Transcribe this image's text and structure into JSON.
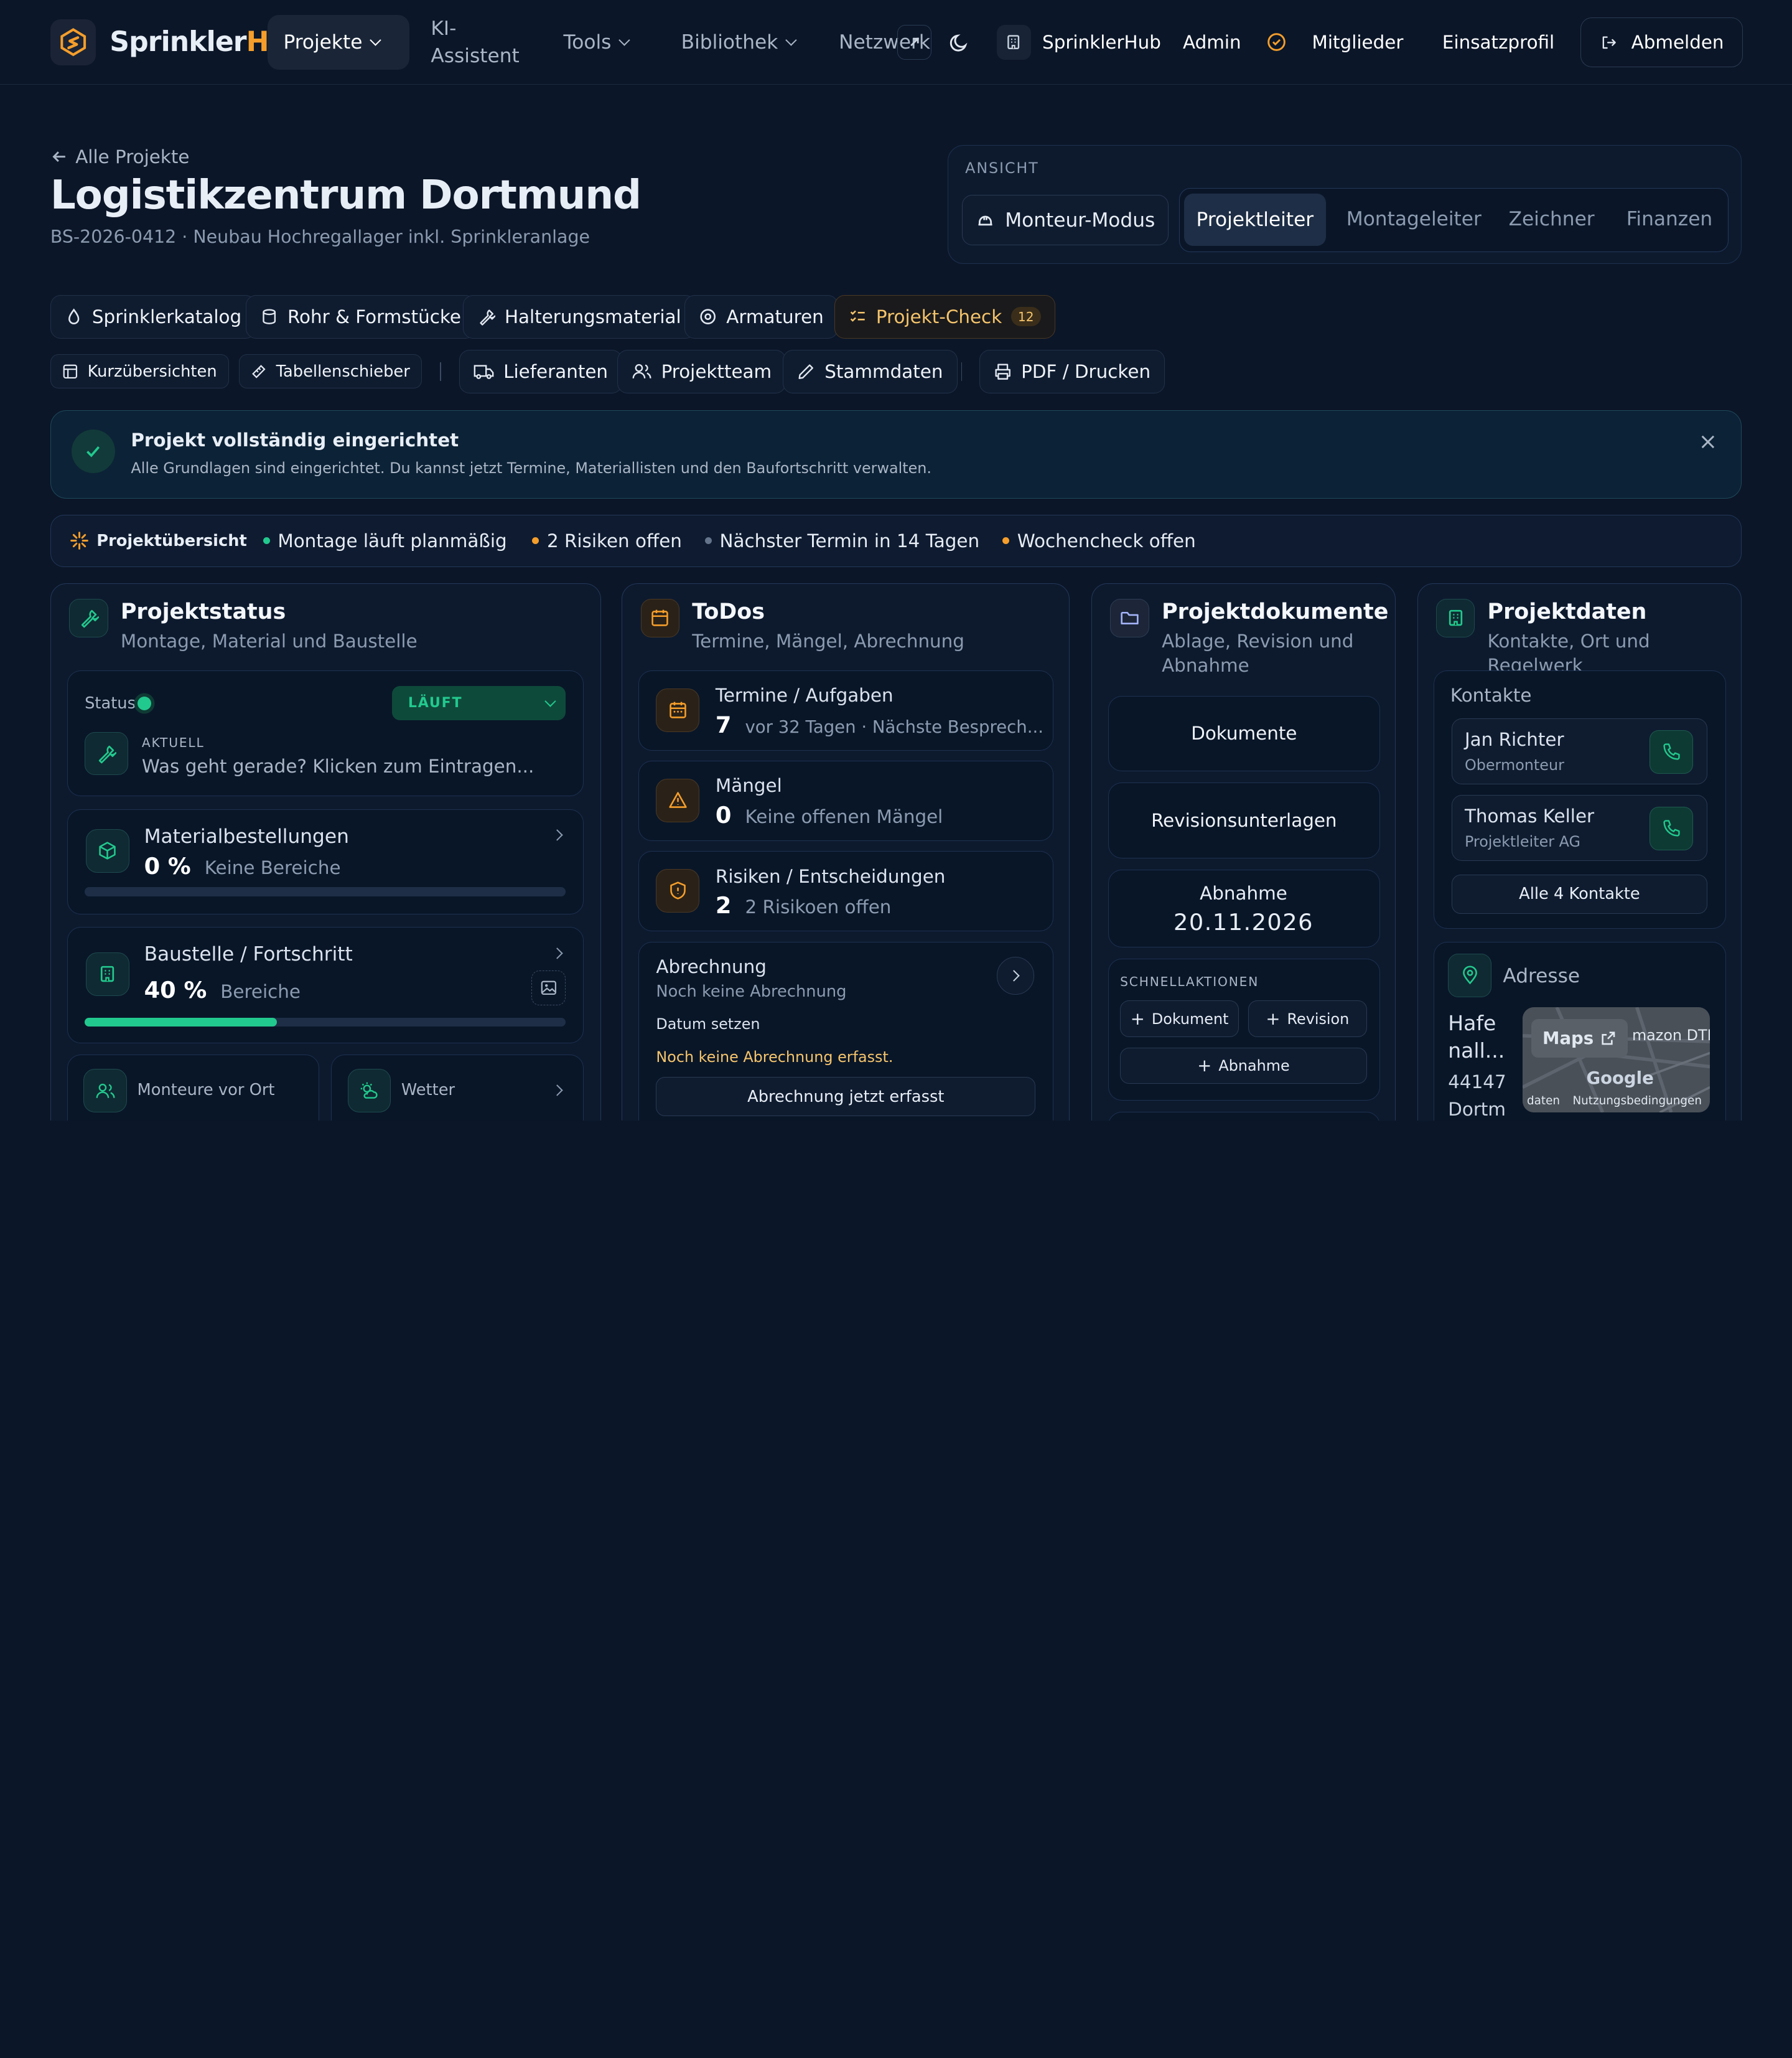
{
  "nav": {
    "brand_a": "Sprinkler",
    "brand_b": "Hub",
    "items": [
      "Projekte",
      "KI-\nAssistent",
      "Tools",
      "Bibliothek",
      "Netzwerk"
    ],
    "org": "SprinklerHub",
    "admin": "Admin",
    "members": "Mitglieder",
    "profile": "Einsatzprofil",
    "logout": "Abmelden"
  },
  "header": {
    "back": "Alle Projekte",
    "title": "Logistikzentrum Dortmund",
    "subtitle": "BS-2026-0412 · Neubau Hochregallager inkl. Sprinkleranlage"
  },
  "view": {
    "label": "ANSICHT",
    "monteur": "Monteur-Modus",
    "roles": [
      "Projektleiter",
      "Montageleiter",
      "Zeichner",
      "Finanzen"
    ],
    "active_role": "Projektleiter"
  },
  "toolbar1": [
    "Sprinklerkatalog",
    "Rohr & Formstücke",
    "Halterungsmaterial",
    "Armaturen",
    "Projekt-Check"
  ],
  "toolbar1_badge": "12",
  "toolbar2": [
    "Kurzübersichten",
    "Tabellenschieber",
    "Lieferanten",
    "Projektteam",
    "Stammdaten",
    "PDF / Drucken"
  ],
  "banner": {
    "title": "Projekt vollständig eingerichtet",
    "text": "Alle Grundlagen sind eingerichtet. Du kannst jetzt Termine, Materiallisten und den Baufortschritt verwalten."
  },
  "overview": {
    "label": "Projektübersicht",
    "items": [
      "Montage läuft planmäßig",
      "2 Risiken offen",
      "Nächster Termin in 14 Tagen",
      "Wochencheck offen"
    ],
    "colors": [
      "#22c98e",
      "#f59e2b",
      "#64748b",
      "#f59e2b"
    ]
  },
  "status": {
    "title": "Projektstatus",
    "subtitle": "Montage, Material und Baustelle",
    "status_label": "Status",
    "status_value": "LÄUFT",
    "current_label": "AKTUELL",
    "current_placeholder": "Was geht gerade? Klicken zum Eintragen...",
    "material_title": "Materialbestellungen",
    "material_value": "0 %",
    "material_note": "Keine Bereiche",
    "material_progress": 0,
    "site_title": "Baustelle / Fortschritt",
    "site_value": "40 %",
    "site_note": "Bereiche",
    "site_progress": 0.4,
    "monteure": "Monteure vor Ort",
    "weather": "Wetter"
  },
  "todos": {
    "title": "ToDos",
    "subtitle": "Termine, Mängel, Abrechnung",
    "items": [
      {
        "title": "Termine / Aufgaben",
        "count": "7",
        "note": "vor 32 Tagen · Nächste Besprech..."
      },
      {
        "title": "Mängel",
        "count": "0",
        "note": "Keine offenen Mängel"
      },
      {
        "title": "Risiken / Entscheidungen",
        "count": "2",
        "note": "2 Risikoen offen"
      }
    ],
    "billing_title": "Abrechnung",
    "billing_sub": "Noch keine Abrechnung",
    "billing_date": "Datum setzen",
    "billing_warn": "Noch keine Abrechnung erfasst.",
    "billing_btn": "Abrechnung jetzt erfasst"
  },
  "documents": {
    "title": "Projektdokumente",
    "subtitle": "Ablage, Revision und Abnahme",
    "docs": "Dokumente",
    "revision": "Revisionsunterlagen",
    "acceptance_label": "Abnahme",
    "acceptance_date": "20.11.2026",
    "quick_label": "SCHNELLAKTIONEN",
    "quick": [
      "Dokument",
      "Revision",
      "Abnahme"
    ]
  },
  "projectdata": {
    "title": "Projektdaten",
    "subtitle": "Kontakte, Ort und Regelwerk",
    "contacts_label": "Kontakte",
    "contacts": [
      {
        "name": "Jan Richter",
        "role": "Obermonteur"
      },
      {
        "name": "Thomas Keller",
        "role": "Projektleiter AG"
      }
    ],
    "all_contacts": "Alle 4 Kontakte",
    "address_label": "Adresse",
    "address_line1": "Hafe",
    "address_line2": "nall...",
    "zip": "44147",
    "city": "Dortm",
    "map_btn": "Maps",
    "map_label": "mazon DTM",
    "map_google": "Google",
    "map_data": "daten",
    "map_terms": "Nutzungsbedingungen"
  },
  "colors": {
    "accent": "#f59e2b",
    "teal": "#22c98e",
    "bg": "#0b1628"
  }
}
